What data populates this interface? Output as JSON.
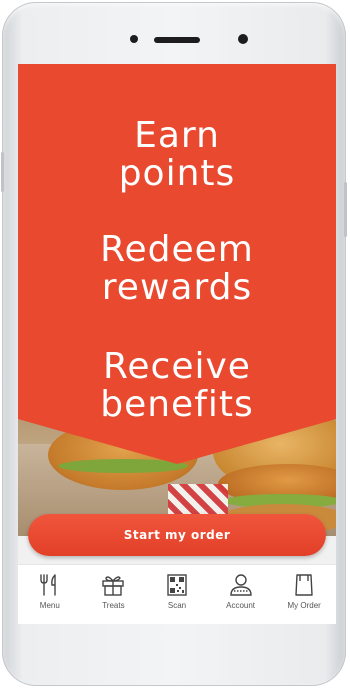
{
  "hero": {
    "lines": [
      {
        "line1": "Earn",
        "line2": "points"
      },
      {
        "line1": "Redeem",
        "line2": "rewards"
      },
      {
        "line1": "Receive",
        "line2": "benefits"
      }
    ]
  },
  "cta": {
    "label": "Start my order"
  },
  "nav": {
    "items": [
      {
        "label": "Menu",
        "icon": "fork-knife-icon"
      },
      {
        "label": "Treats",
        "icon": "gift-icon"
      },
      {
        "label": "Scan",
        "icon": "qr-code-icon"
      },
      {
        "label": "Account",
        "icon": "person-icon"
      },
      {
        "label": "My Order",
        "icon": "bag-icon"
      }
    ]
  },
  "colors": {
    "brand": "#e8492f",
    "nav_bg": "#ffffff"
  }
}
